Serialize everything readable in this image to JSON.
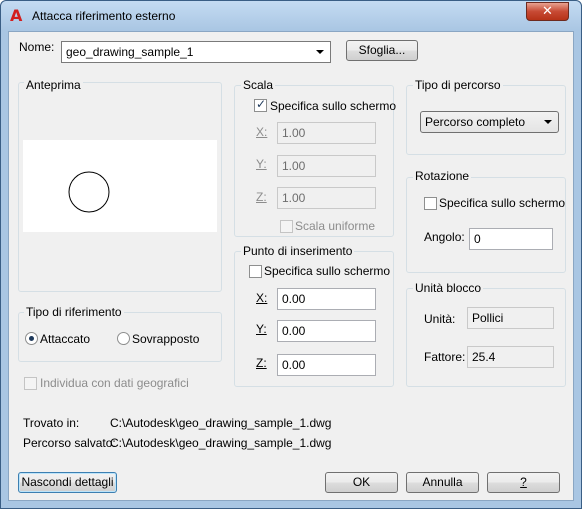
{
  "window": {
    "title": "Attacca riferimento esterno",
    "close_glyph": "✕",
    "app_icon": "autocad-a-icon"
  },
  "name_row": {
    "label": "Nome:",
    "value": "geo_drawing_sample_1",
    "browse_label": "Sfoglia..."
  },
  "preview": {
    "title": "Anteprima",
    "shape": "circle"
  },
  "ref_type": {
    "title": "Tipo di riferimento",
    "attach_label": "Attaccato",
    "overlay_label": "Sovrapposto",
    "selected": "attach"
  },
  "geo_checkbox": {
    "label": "Individua con dati geografici",
    "checked": false,
    "enabled": false
  },
  "scale": {
    "title": "Scala",
    "specify_label": "Specifica sullo schermo",
    "specify_checked": true,
    "x_label": "X:",
    "x_value": "1.00",
    "y_label": "Y:",
    "y_value": "1.00",
    "z_label": "Z:",
    "z_value": "1.00",
    "uniform_label": "Scala uniforme",
    "uniform_checked": false
  },
  "insertion": {
    "title": "Punto di inserimento",
    "specify_label": "Specifica sullo schermo",
    "specify_checked": false,
    "x_label": "X:",
    "x_value": "0.00",
    "y_label": "Y:",
    "y_value": "0.00",
    "z_label": "Z:",
    "z_value": "0.00"
  },
  "path_type": {
    "title": "Tipo di percorso",
    "value": "Percorso completo"
  },
  "rotation": {
    "title": "Rotazione",
    "specify_label": "Specifica sullo schermo",
    "specify_checked": false,
    "angle_label": "Angolo:",
    "angle_value": "0"
  },
  "block_unit": {
    "title": "Unità blocco",
    "unit_label": "Unità:",
    "unit_value": "Pollici",
    "factor_label": "Fattore:",
    "factor_value": "25.4"
  },
  "info": {
    "found_label": "Trovato in:",
    "found_value": "C:\\Autodesk\\geo_drawing_sample_1.dwg",
    "saved_label": "Percorso salvato:",
    "saved_value": "C:\\Autodesk\\geo_drawing_sample_1.dwg"
  },
  "buttons": {
    "hide_details": "Nascondi dettagli",
    "ok": "OK",
    "cancel": "Annulla",
    "help": "?"
  }
}
